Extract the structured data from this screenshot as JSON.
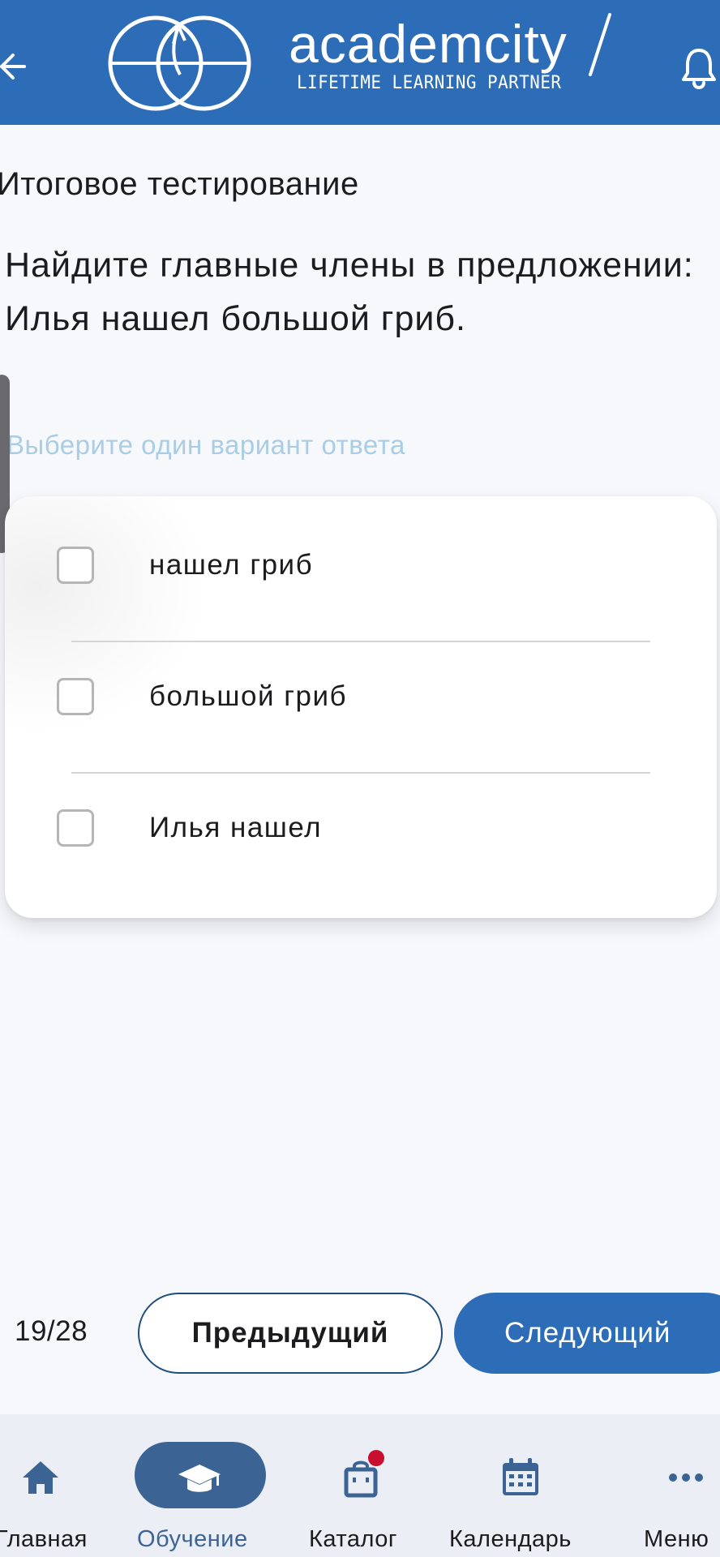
{
  "header": {
    "logo_name": "academcity",
    "logo_tagline": "LIFETIME LEARNING PARTNER",
    "back_icon": "arrow-left-icon",
    "bell_icon": "bell-icon",
    "color": "#2d6db8"
  },
  "test": {
    "title": "Итоговое тестирование",
    "question": "Найдите главные члены в предложении: Илья нашел большой гриб.",
    "hint": "Выберите один вариант ответа",
    "options": [
      {
        "label": "нашел гриб",
        "checked": false
      },
      {
        "label": "большой гриб",
        "checked": false
      },
      {
        "label": "Илья нашел",
        "checked": false
      }
    ]
  },
  "pager": {
    "counter": "19/28",
    "prev_label": "Предыдущий",
    "next_label": "Следующий"
  },
  "tabbar": {
    "items": [
      {
        "label": "Главная",
        "icon": "home-icon",
        "active": false
      },
      {
        "label": "Обучение",
        "icon": "graduation-cap-icon",
        "active": true
      },
      {
        "label": "Каталог",
        "icon": "shopping-bag-icon",
        "active": false,
        "badge": true
      },
      {
        "label": "Календарь",
        "icon": "calendar-icon",
        "active": false
      },
      {
        "label": "Меню",
        "icon": "more-dots-icon",
        "active": false
      }
    ],
    "active_color": "#3b6495",
    "inactive_icon_color": "#3b6495",
    "active_label_color": "#3b6495"
  }
}
